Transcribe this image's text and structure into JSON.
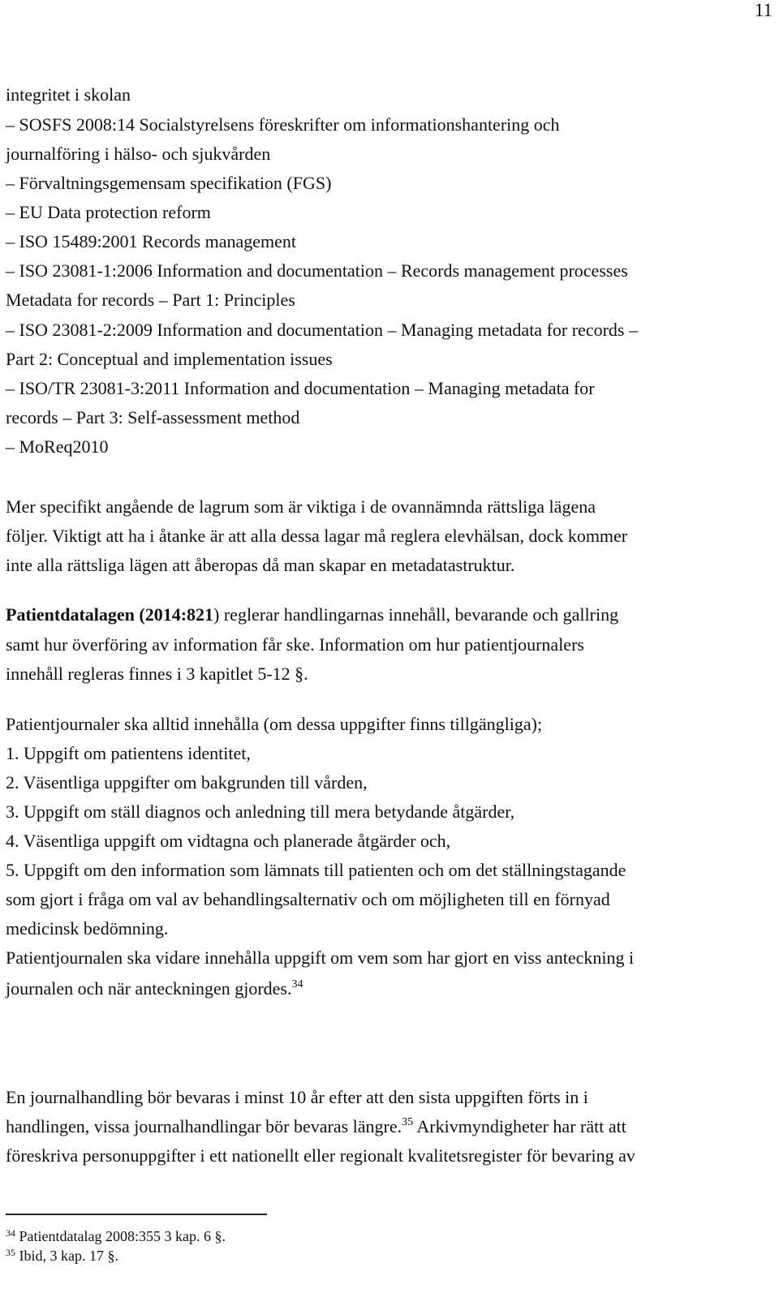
{
  "page_number": "11",
  "list_intro": "integritet i skolan",
  "list_items": [
    "– SOSFS 2008:14 Socialstyrelsens föreskrifter om informationshantering och",
    "journalföring i hälso- och sjukvården",
    "– Förvaltningsgemensam specifikation (FGS)",
    "– EU Data protection reform",
    "– ISO 15489:2001 Records management",
    "– ISO 23081-1:2006 Information and documentation – Records management processes",
    "Metadata for records – Part 1: Principles",
    "– ISO 23081-2:2009 Information and documentation – Managing metadata for records –",
    "Part 2: Conceptual and implementation issues",
    "– ISO/TR 23081-3:2011 Information and documentation – Managing metadata for",
    "records – Part 3: Self-assessment method",
    "– MoReq2010"
  ],
  "paragraph1": [
    "Mer specifikt angående de lagrum som är viktiga i de ovannämnda rättsliga lägena",
    "följer. Viktigt att ha i åtanke är att alla dessa lagar må reglera elevhälsan, dock kommer",
    "inte alla rättsliga lägen att åberopas då man skapar en metadatastruktur."
  ],
  "paragraph2": {
    "bold_lead": "Patientdatalagen (2014:821",
    "line1_rest": ") reglerar handlingarnas innehåll, bevarande och gallring",
    "line2": "samt hur överföring av information får ske. Information om hur patientjournalers",
    "line3": "innehåll regleras finnes i 3 kapitlet 5-12 §."
  },
  "paragraph3": {
    "intro": "Patientjournaler ska alltid innehålla (om dessa uppgifter finns tillgängliga);",
    "items": [
      "1. Uppgift om patientens identitet,",
      "2. Väsentliga uppgifter om bakgrunden till vården,",
      "3. Uppgift om ställ diagnos och anledning till mera betydande åtgärder,",
      "4. Väsentliga uppgift om vidtagna och planerade åtgärder och,",
      "5. Uppgift om den information som lämnats till patienten och om det ställningstagande",
      "som gjort i fråga om val av behandlingsalternativ och om möjligheten till en förnyad",
      "medicinsk bedömning."
    ],
    "closing_line1": "Patientjournalen ska vidare innehålla uppgift om vem som har gjort en viss anteckning i",
    "closing_line2": "journalen och när anteckningen gjordes.",
    "closing_footnote_ref": "34"
  },
  "paragraph4": {
    "line1": "En journalhandling bör bevaras i minst 10 år efter att den sista uppgiften förts in i",
    "line2_before": "handlingen, vissa journalhandlingar bör bevaras längre.",
    "line2_footnote_ref": "35",
    "line2_after": " Arkivmyndigheter har rätt att",
    "line3": "föreskriva personuppgifter i ett nationellt eller regionalt kvalitetsregister för bevaring av"
  },
  "footnotes": [
    {
      "number": "34",
      "text": " Patientdatalag 2008:355 3 kap. 6 §."
    },
    {
      "number": "35",
      "text": " Ibid, 3 kap. 17 §."
    }
  ]
}
